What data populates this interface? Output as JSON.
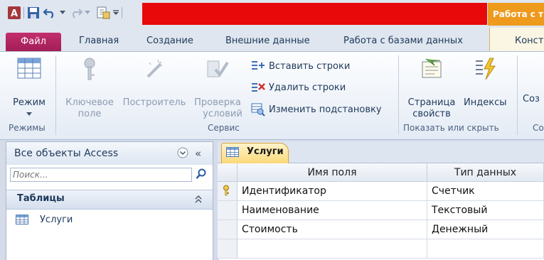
{
  "app": {
    "context_title": "Работа с т"
  },
  "tabs": {
    "file": "Файл",
    "home": "Главная",
    "create": "Создание",
    "external": "Внешние данные",
    "database": "Работа с базами данных",
    "design": "Конст"
  },
  "ribbon": {
    "mode_label": "Режим",
    "mode_group": "Режимы",
    "key_label_1": "Ключевое",
    "key_label_2": "поле",
    "builder_label": "Построитель",
    "validate_label_1": "Проверка",
    "validate_label_2": "условий",
    "insert_rows": "Вставить строки",
    "delete_rows": "Удалить строки",
    "modify_lookup": "Изменить подстановку",
    "service_group": "Сервис",
    "props_label_1": "Страница",
    "props_label_2": "свойств",
    "indexes_label": "Индексы",
    "showhide_group": "Показать или скрыть",
    "create_label": "Соз",
    "next_group": "Со"
  },
  "nav": {
    "title": "Все объекты Access",
    "search_placeholder": "Поиск...",
    "group_title": "Таблицы",
    "items": [
      {
        "label": "Услуги"
      }
    ]
  },
  "document": {
    "tab_label": "Услуги",
    "columns": [
      "Имя поля",
      "Тип данных"
    ],
    "rows": [
      {
        "field": "Идентификатор",
        "type": "Счетчик",
        "primary_key": true
      },
      {
        "field": "Наименование",
        "type": "Текстовый",
        "primary_key": false
      },
      {
        "field": "Стоимость",
        "type": "Денежный",
        "primary_key": false
      }
    ]
  },
  "colors": {
    "file_tab": "#b3286a",
    "context_tab": "#ee9a1d",
    "doc_tab": "#fbd97a"
  }
}
